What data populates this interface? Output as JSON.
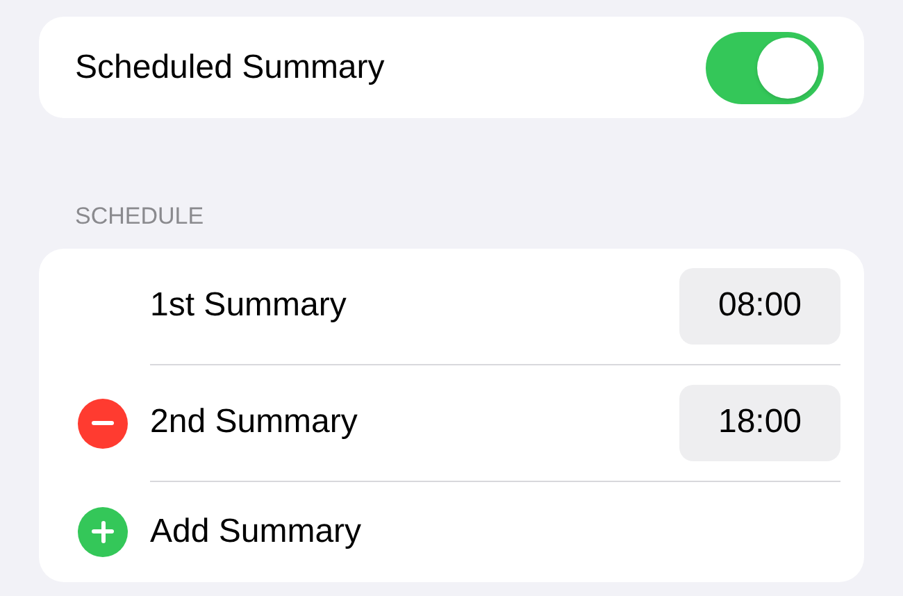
{
  "toggle_row": {
    "label": "Scheduled Summary",
    "on": true
  },
  "section_header": "SCHEDULE",
  "rows": [
    {
      "kind": "time",
      "label": "1st Summary",
      "time": "08:00",
      "removable": false
    },
    {
      "kind": "time",
      "label": "2nd Summary",
      "time": "18:00",
      "removable": true
    },
    {
      "kind": "add",
      "label": "Add Summary"
    }
  ]
}
